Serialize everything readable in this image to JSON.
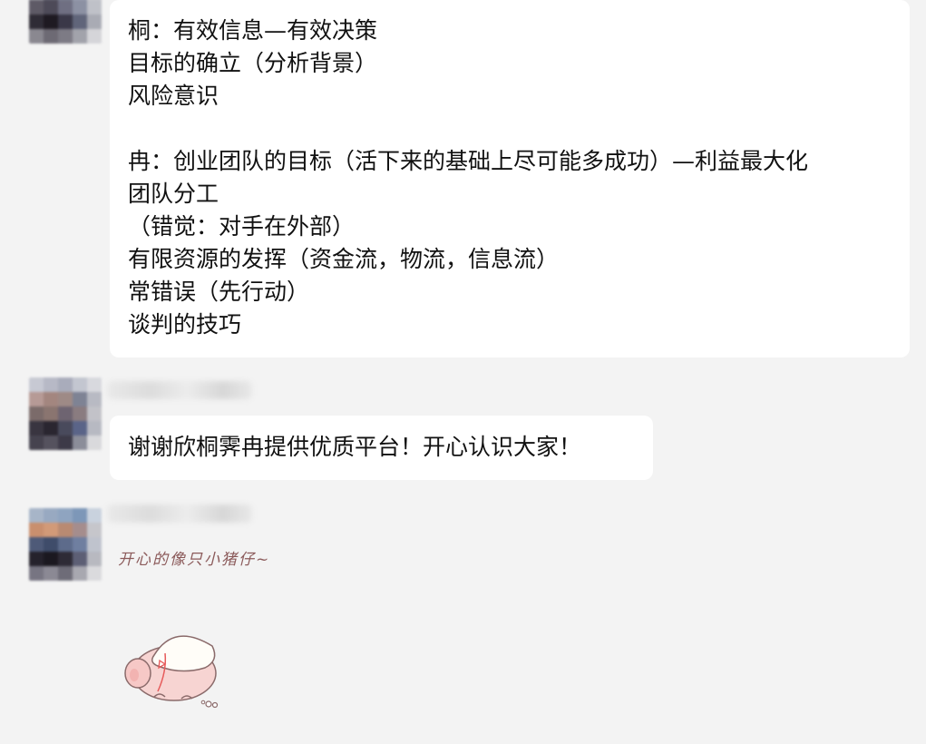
{
  "messages": [
    {
      "lines": [
        "桐：有效信息—有效决策",
        "目标的确立（分析背景）",
        "风险意识",
        "",
        "冉：创业团队的目标（活下来的基础上尽可能多成功）—利益最大化",
        "团队分工",
        "（错觉：对手在外部）",
        "有限资源的发挥（资金流，物流，信息流）",
        "常错误（先行动）",
        "谈判的技巧"
      ]
    },
    {
      "lines": [
        "谢谢欣桐霁冉提供优质平台！开心认识大家！"
      ]
    },
    {
      "sticker_caption": "开心的像只小猪仔~",
      "sticker_icon": "pig-sticker"
    }
  ],
  "colors": {
    "background": "#f3f3f3",
    "bubble": "#ffffff",
    "text": "#111111"
  }
}
